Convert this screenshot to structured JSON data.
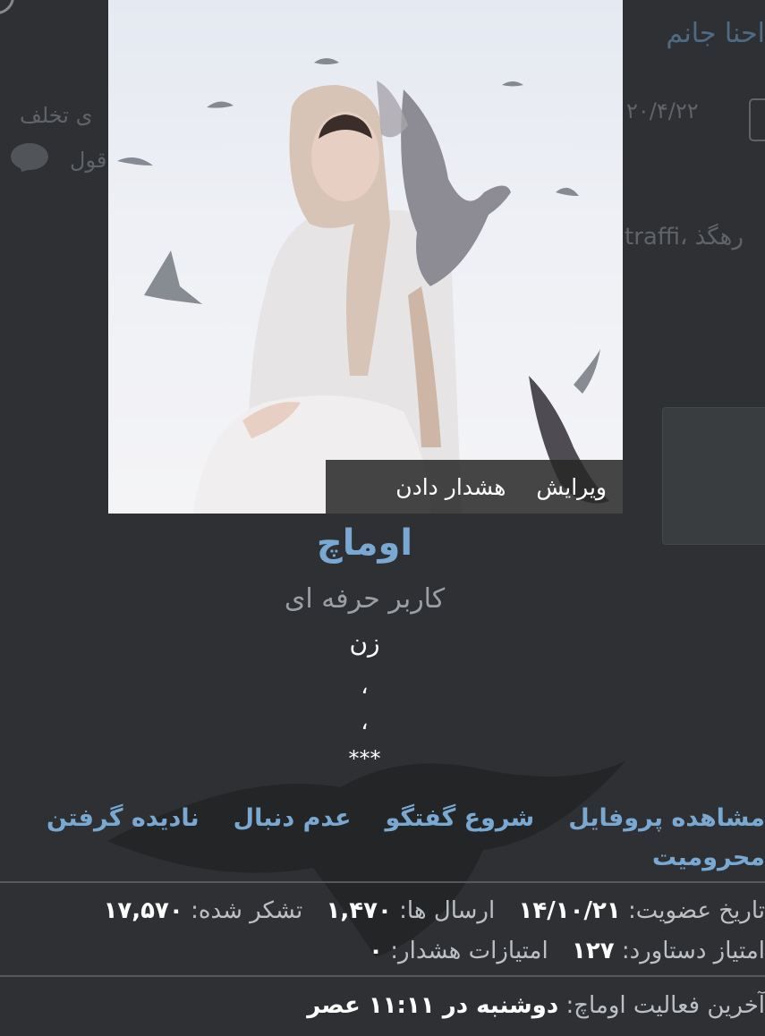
{
  "background": {
    "thread_title": "احنا جانم",
    "date": "۲۰/۴/۲۲",
    "snippet_1": "ی تخلف",
    "snippet_2": "قول",
    "tags": "traffi، رهگذ"
  },
  "photo_actions": {
    "edit_label": "ویرایش",
    "warn_label": "هشدار دادن"
  },
  "profile": {
    "username": "اوماچ",
    "role": "کاربر حرفه ای",
    "gender": "زن",
    "line1": "،",
    "line2": "،",
    "stars": "***"
  },
  "actions": {
    "view_profile": "مشاهده پروفایل",
    "start_conversation": "شروع گفتگو",
    "unfollow": "عدم دنبال",
    "ignore": "نادیده گرفتن",
    "ban": "محرومیت"
  },
  "stats": {
    "joined_label": "تاریخ عضویت:",
    "joined_value": "۱۴/۱۰/۲۱",
    "posts_label": "ارسال ها:",
    "posts_value": "۱,۴۷۰",
    "thanks_label": "تشکر شده:",
    "thanks_value": "۱۷,۵۷۰",
    "points_label": "امتیاز دستاورد:",
    "points_value": "۱۲۷",
    "warnings_label": "امتیازات هشدار:",
    "warnings_value": "۰"
  },
  "last_activity": {
    "label": "آخرین فعالیت اوماچ:",
    "value": "دوشنبه در ۱۱:۱۱ عصر"
  },
  "colors": {
    "background": "#2e3033",
    "link": "#79a9d3",
    "muted": "#9a9fa5"
  }
}
